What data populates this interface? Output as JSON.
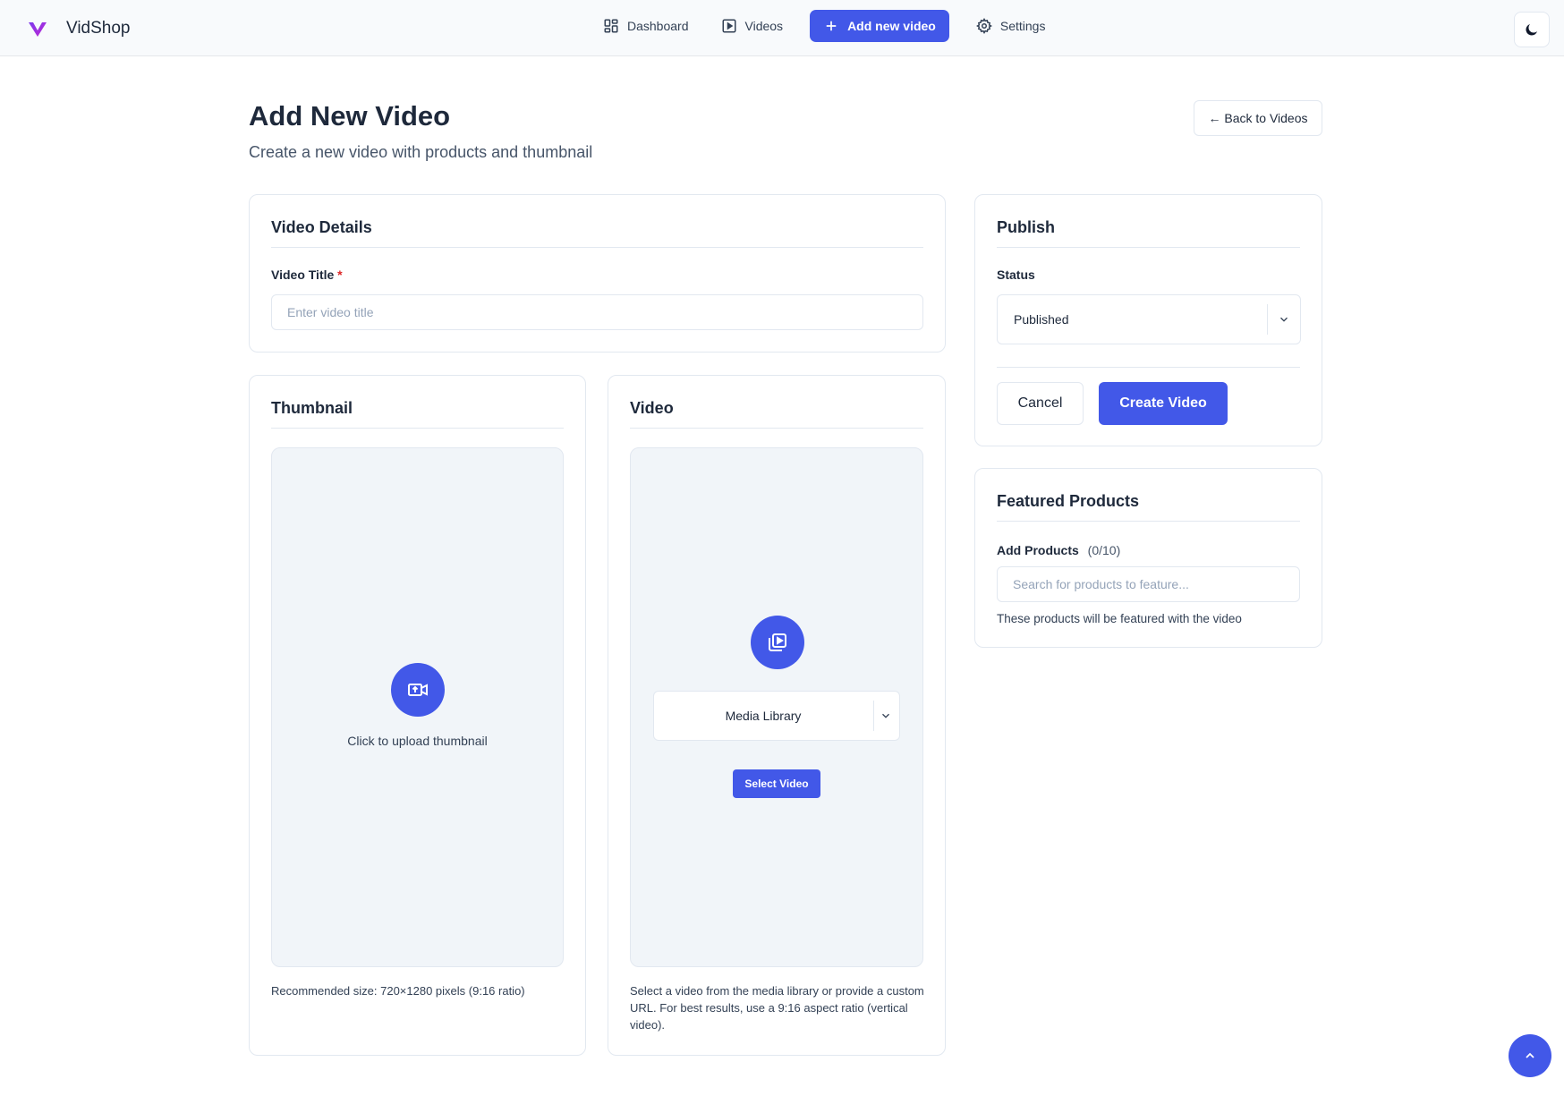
{
  "brand": {
    "name": "VidShop",
    "logo_icon": "vidshop-v-logo"
  },
  "nav": {
    "items": [
      {
        "label": "Dashboard",
        "icon": "dashboard-icon"
      },
      {
        "label": "Videos",
        "icon": "video-icon"
      },
      {
        "label": "Add new video",
        "icon": "plus-icon",
        "active": true
      },
      {
        "label": "Settings",
        "icon": "gear-icon"
      }
    ],
    "theme_toggle_icon": "moon-icon"
  },
  "header": {
    "title": "Add New Video",
    "subtitle": "Create a new video with products and thumbnail",
    "back_label": "← Back to Videos"
  },
  "video_details": {
    "title": "Video Details",
    "field_label": "Video Title",
    "required_mark": "*",
    "placeholder": "Enter video title"
  },
  "thumbnail": {
    "title": "Thumbnail",
    "upload_text": "Click to upload thumbnail",
    "hint": "Recommended size: 720×1280 pixels (9:16 ratio)"
  },
  "video": {
    "title": "Video",
    "source_selected": "Media Library",
    "select_label": "Select Video",
    "hint": "Select a video from the media library or provide a custom URL. For best results, use a 9:16 aspect ratio (vertical video)."
  },
  "publish": {
    "title": "Publish",
    "status_label": "Status",
    "status_value": "Published",
    "cancel_label": "Cancel",
    "create_label": "Create Video"
  },
  "featured_products": {
    "title": "Featured Products",
    "add_label": "Add Products",
    "count": "(0/10)",
    "placeholder": "Search for products to feature...",
    "hint": "These products will be featured with the video"
  },
  "colors": {
    "accent": "#4258e8",
    "brand_gradient_start": "#7c3aed",
    "brand_gradient_end": "#c026d3"
  }
}
